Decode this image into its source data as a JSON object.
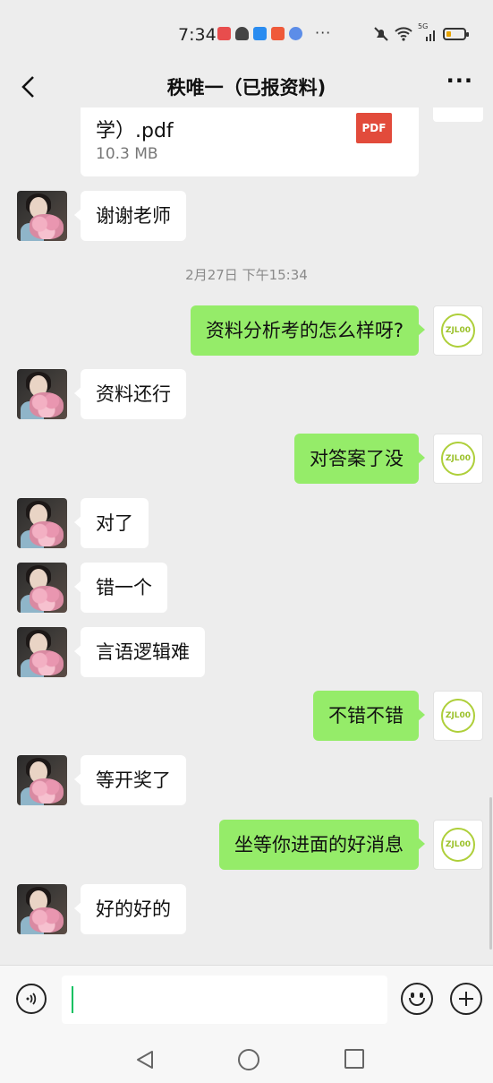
{
  "status_bar": {
    "time": "7:34",
    "more": "···",
    "network": "5G",
    "battery_level": 0.25
  },
  "header": {
    "title": "秩唯一（已报资料)",
    "menu": "···"
  },
  "file_message": {
    "file_name": "学）.pdf",
    "file_size": "10.3 MB",
    "file_type": "PDF"
  },
  "timestamp": "2月27日 下午15:34",
  "messages": [
    {
      "from": "peer",
      "text": "谢谢老师"
    },
    {
      "from": "me",
      "text": "资料分析考的怎么样呀?"
    },
    {
      "from": "peer",
      "text": "资料还行"
    },
    {
      "from": "me",
      "text": "对答案了没"
    },
    {
      "from": "peer",
      "text": "对了"
    },
    {
      "from": "peer",
      "text": "错一个"
    },
    {
      "from": "peer",
      "text": "言语逻辑难"
    },
    {
      "from": "me",
      "text": "不错不错"
    },
    {
      "from": "peer",
      "text": "等开奖了"
    },
    {
      "from": "me",
      "text": "坐等你进面的好消息"
    },
    {
      "from": "peer",
      "text": "好的好的"
    }
  ],
  "my_avatar_logo": "ZJL00",
  "input": {
    "value": "",
    "placeholder": ""
  },
  "icons": {
    "back": "chevron-left-icon",
    "voice": "voice-icon",
    "emoji": "emoji-icon",
    "plus": "plus-icon"
  }
}
